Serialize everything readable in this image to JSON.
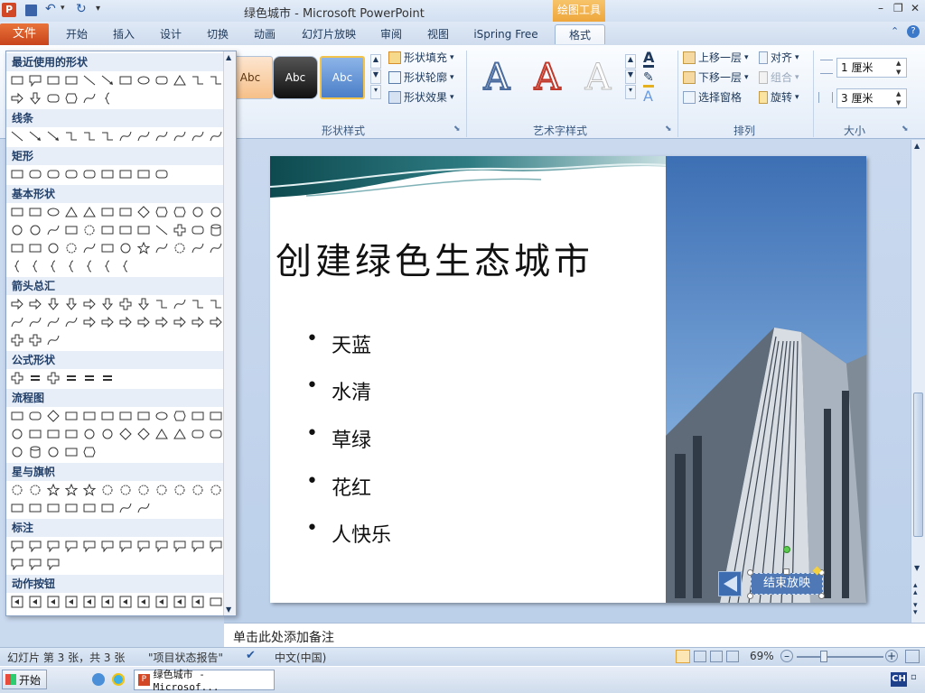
{
  "window": {
    "title": "绿色城市 - Microsoft PowerPoint",
    "contextual_tab_group": "绘图工具"
  },
  "tabs": [
    {
      "label": "文件"
    },
    {
      "label": "开始"
    },
    {
      "label": "插入"
    },
    {
      "label": "设计"
    },
    {
      "label": "切换"
    },
    {
      "label": "动画"
    },
    {
      "label": "幻灯片放映"
    },
    {
      "label": "审阅"
    },
    {
      "label": "视图"
    },
    {
      "label": "iSpring Free"
    },
    {
      "label": "格式"
    }
  ],
  "ribbon": {
    "shape_styles": {
      "samples": [
        "Abc",
        "Abc",
        "Abc"
      ],
      "fill": "形状填充",
      "outline": "形状轮廓",
      "effects": "形状效果",
      "label": "形状样式"
    },
    "wordart": {
      "sample": "A",
      "label": "艺术字样式"
    },
    "arrange": {
      "bring_forward": "上移一层",
      "send_backward": "下移一层",
      "selection_pane": "选择窗格",
      "align": "对齐",
      "group": "组合",
      "rotate": "旋转",
      "label": "排列"
    },
    "size": {
      "height": "1 厘米",
      "width": "3 厘米",
      "label": "大小"
    }
  },
  "shapes_gallery": {
    "sections": [
      {
        "title": "最近使用的形状"
      },
      {
        "title": "线条"
      },
      {
        "title": "矩形"
      },
      {
        "title": "基本形状"
      },
      {
        "title": "箭头总汇"
      },
      {
        "title": "公式形状"
      },
      {
        "title": "流程图"
      },
      {
        "title": "星与旗帜"
      },
      {
        "title": "标注"
      },
      {
        "title": "动作按钮"
      }
    ]
  },
  "slide": {
    "title": "创建绿色生态城市",
    "bullets": [
      "天蓝",
      "水清",
      "草绿",
      "花红",
      "人快乐"
    ],
    "end_button": "结束放映"
  },
  "notes": {
    "placeholder": "单击此处添加备注"
  },
  "statusbar": {
    "slide_info": "幻灯片 第 3 张，共 3 张",
    "theme": "\"项目状态报告\"",
    "language": "中文(中国)",
    "zoom": "69%"
  },
  "taskbar": {
    "start": "开始",
    "app": "绿色城市 - Microsof...",
    "ime": "CH"
  },
  "colors": {
    "file_tab": "#d35a2a",
    "contextual_tab": "#f0b04a",
    "accent": "#2b579a"
  }
}
